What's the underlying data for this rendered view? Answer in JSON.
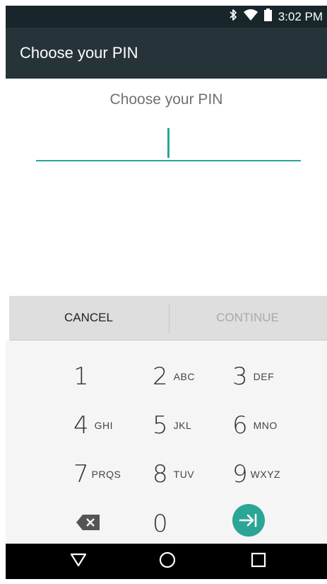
{
  "status_bar": {
    "time": "3:02 PM",
    "icons": [
      "bluetooth-icon",
      "wifi-icon",
      "battery-icon"
    ]
  },
  "app_bar": {
    "title": "Choose your PIN"
  },
  "pin_entry": {
    "prompt": "Choose your PIN",
    "value": ""
  },
  "actions": {
    "cancel_label": "CANCEL",
    "continue_label": "CONTINUE"
  },
  "keypad": {
    "keys": [
      {
        "digit": "1",
        "letters": ""
      },
      {
        "digit": "2",
        "letters": "ABC"
      },
      {
        "digit": "3",
        "letters": "DEF"
      },
      {
        "digit": "4",
        "letters": "GHI"
      },
      {
        "digit": "5",
        "letters": "JKL"
      },
      {
        "digit": "6",
        "letters": "MNO"
      },
      {
        "digit": "7",
        "letters": "PRQS"
      },
      {
        "digit": "8",
        "letters": "TUV"
      },
      {
        "digit": "9",
        "letters": "WXYZ"
      },
      {
        "digit": "0",
        "letters": ""
      }
    ],
    "backspace_icon": "backspace-icon",
    "enter_icon": "enter-icon"
  },
  "nav_bar": {
    "icons": [
      "back-triangle-icon",
      "home-circle-icon",
      "recents-square-icon"
    ]
  },
  "colors": {
    "accent": "#2aa596",
    "app_bar": "#26343a",
    "status_bar": "#18262b",
    "action_bar": "#dedede",
    "keypad_bg": "#f5f5f5"
  }
}
